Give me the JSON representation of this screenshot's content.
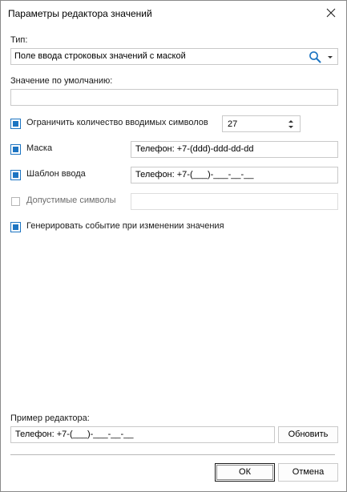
{
  "window": {
    "title": "Параметры редактора значений"
  },
  "type": {
    "label": "Тип:",
    "value": "Поле ввода строковых значений с маской"
  },
  "default_value": {
    "label": "Значение по умолчанию:",
    "value": ""
  },
  "limit": {
    "label": "Ограничить количество вводимых символов",
    "checked": true,
    "value": "27"
  },
  "mask": {
    "label": "Маска",
    "checked": true,
    "value": "Телефон: +7-(ddd)-ddd-dd-dd"
  },
  "template": {
    "label": "Шаблон ввода",
    "checked": true,
    "value": "Телефон: +7-(___)-___-__-__"
  },
  "allowed": {
    "label": "Допустимые символы",
    "checked": false,
    "value": ""
  },
  "event": {
    "label": "Генерировать событие при изменении значения",
    "checked": true
  },
  "preview": {
    "label": "Пример редактора:",
    "value": "Телефон: +7-(___)-___-__-__",
    "refresh_label": "Обновить"
  },
  "buttons": {
    "ok": "ОК",
    "cancel": "Отмена"
  },
  "colors": {
    "accent": "#1c74c2",
    "border": "#c9c9c9"
  },
  "icons": {
    "search": "search-icon",
    "dropdown": "chevron-down-icon",
    "close": "close-icon",
    "spin_up": "spin-up-icon",
    "spin_down": "spin-down-icon"
  }
}
